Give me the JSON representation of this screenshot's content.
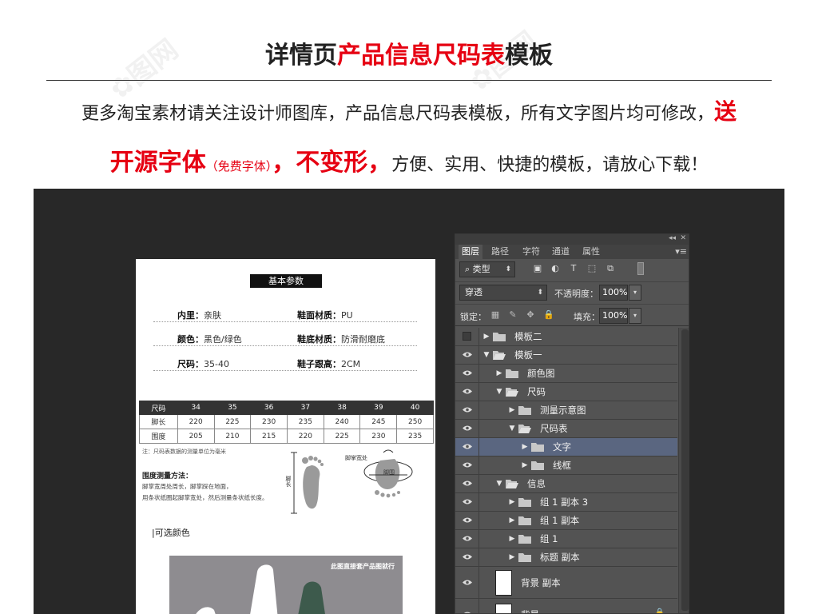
{
  "header": {
    "title_prefix": "详情页",
    "title_highlight": "产品信息尺码表",
    "title_suffix": "模板",
    "line1_text": "更多淘宝素材请关注设计师图库，产品信息尺码表模板，所有文字图片均可修改，",
    "line1_highlight": "送",
    "line2_big1": "开源字体",
    "line2_small": "（免费字体）",
    "line2_big2": "，不变形，",
    "line2_text": "方便、实用、快捷的模板，请放心下载！"
  },
  "document": {
    "section_title": "基本参数",
    "params": [
      {
        "label": "内里：",
        "value": "亲肤"
      },
      {
        "label": "鞋面材质：",
        "value": "PU"
      },
      {
        "label": "颜色：",
        "value": "黑色/绿色"
      },
      {
        "label": "鞋底材质：",
        "value": "防滑耐磨底"
      },
      {
        "label": "尺码：",
        "value": "35-40"
      },
      {
        "label": "鞋子跟高：",
        "value": "2CM"
      }
    ],
    "size_table": {
      "header": [
        "尺码",
        "34",
        "35",
        "36",
        "37",
        "38",
        "39",
        "40"
      ],
      "rows": [
        [
          "脚长",
          "220",
          "225",
          "230",
          "235",
          "240",
          "245",
          "250"
        ],
        [
          "围度",
          "205",
          "210",
          "215",
          "220",
          "225",
          "230",
          "235"
        ]
      ]
    },
    "note": "注：尺码表数据的测量单位为毫米",
    "method_title": "围度测量方法：",
    "method_lines": [
      "脚掌宽周处周长，脚掌踩在地面，",
      "用条状纸圈起脚掌宽处，然后测量条状纸长度。"
    ],
    "foot_length_label": "脚长",
    "foot_width_label": "脚掌宽处",
    "foot_girth_label": "脚围",
    "color_title": "|可选颜色",
    "color_caption": "此图直接套产品图就行"
  },
  "panel": {
    "tabs": [
      "图层",
      "路径",
      "字符",
      "通道",
      "属性"
    ],
    "filter_label": "类型",
    "blend_mode": "穿透",
    "opacity_label": "不透明度：",
    "opacity_value": "100%",
    "lock_label": "锁定：",
    "fill_label": "填充：",
    "fill_value": "100%",
    "layers": [
      {
        "name": "模板二",
        "depth": 0,
        "visible": false,
        "expanded": false,
        "selected": false
      },
      {
        "name": "模板一",
        "depth": 0,
        "visible": true,
        "expanded": true,
        "selected": false
      },
      {
        "name": "颜色图",
        "depth": 1,
        "visible": true,
        "expanded": false,
        "selected": false
      },
      {
        "name": "尺码",
        "depth": 1,
        "visible": true,
        "expanded": true,
        "selected": false
      },
      {
        "name": "测量示意图",
        "depth": 2,
        "visible": true,
        "expanded": false,
        "selected": false
      },
      {
        "name": "尺码表",
        "depth": 2,
        "visible": true,
        "expanded": true,
        "selected": false
      },
      {
        "name": "文字",
        "depth": 3,
        "visible": true,
        "expanded": false,
        "selected": true
      },
      {
        "name": "线框",
        "depth": 3,
        "visible": true,
        "expanded": false,
        "selected": false
      },
      {
        "name": "信息",
        "depth": 1,
        "visible": true,
        "expanded": true,
        "selected": false
      },
      {
        "name": "组 1 副本 3",
        "depth": 2,
        "visible": true,
        "expanded": false,
        "selected": false
      },
      {
        "name": "组 1 副本",
        "depth": 2,
        "visible": true,
        "expanded": false,
        "selected": false
      },
      {
        "name": "组 1",
        "depth": 2,
        "visible": true,
        "expanded": false,
        "selected": false
      },
      {
        "name": "标题 副本",
        "depth": 2,
        "visible": true,
        "expanded": false,
        "selected": false
      }
    ],
    "bg_copy_layer": "背景 副本",
    "bg_layer": "背景"
  },
  "colors": {
    "accent_red": "#e60012",
    "stage_bg": "#282828",
    "panel_bg": "#535353",
    "selected_row": "#5a6680"
  }
}
